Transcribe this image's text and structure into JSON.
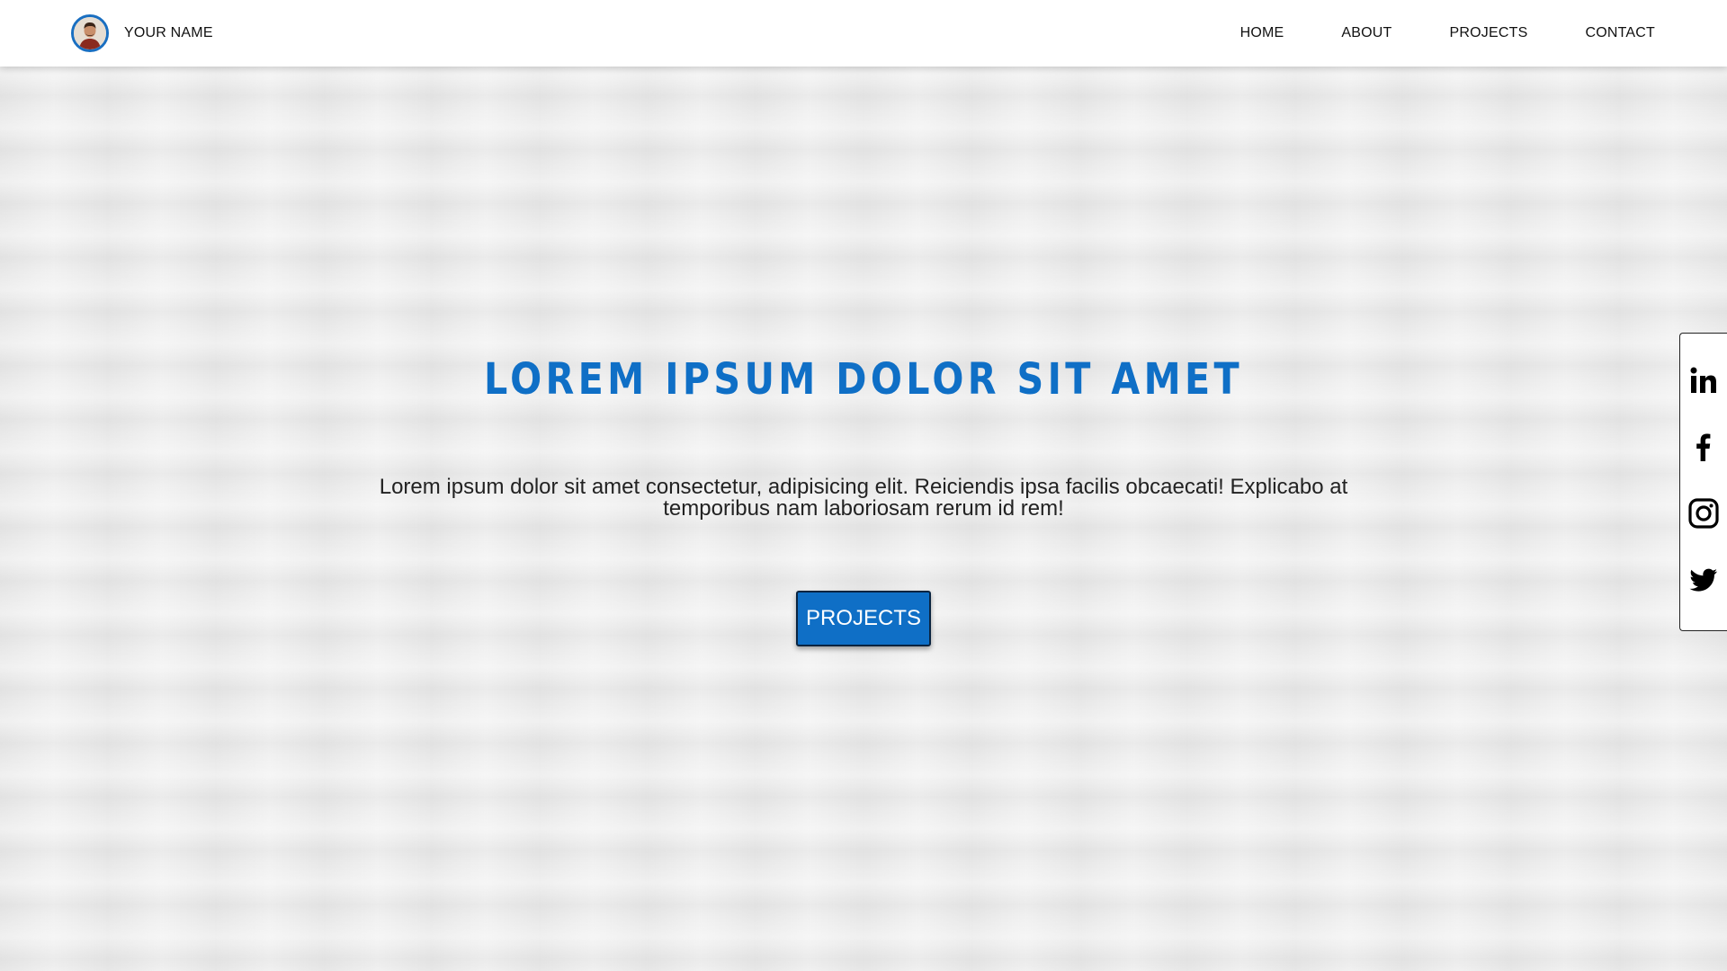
{
  "header": {
    "brand_name": "YOUR NAME",
    "nav": [
      {
        "label": "HOME"
      },
      {
        "label": "ABOUT"
      },
      {
        "label": "PROJECTS"
      },
      {
        "label": "CONTACT"
      }
    ]
  },
  "hero": {
    "title": "LOREM IPSUM DOLOR SIT AMET",
    "text_line1": "Lorem ipsum dolor sit amet consectetur, adipisicing elit. Reiciendis ipsa facilis obcaecati! Explicabo at",
    "text_line2": "temporibus nam laboriosam rerum id rem!",
    "button_label": "PROJECTS"
  },
  "social": [
    {
      "icon": "linkedin-icon"
    },
    {
      "icon": "facebook-icon"
    },
    {
      "icon": "instagram-icon"
    },
    {
      "icon": "twitter-icon"
    }
  ],
  "colors": {
    "accent": "#0f6fc6",
    "background": "#ececec",
    "header": "#ffffff"
  }
}
